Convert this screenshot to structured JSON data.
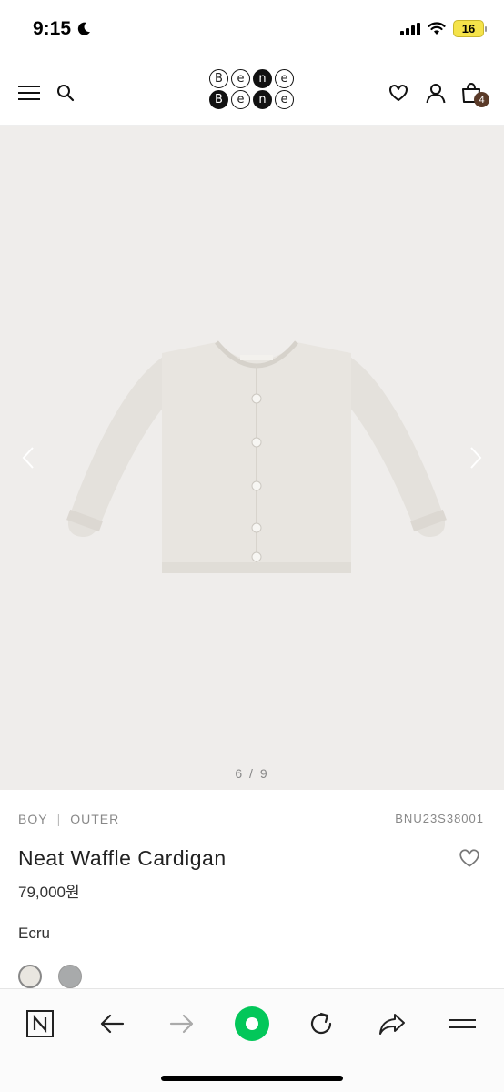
{
  "status_bar": {
    "time": "9:15",
    "battery": "16"
  },
  "header": {
    "logo_letters_top": [
      "B",
      "e",
      "n",
      "e"
    ],
    "logo_letters_bottom": [
      "B",
      "e",
      "n",
      "e"
    ],
    "cart_count": "4",
    "icons": [
      "menu-icon",
      "search-icon",
      "heart-icon",
      "user-icon",
      "shopping-bag-icon"
    ]
  },
  "gallery": {
    "counter": "6 / 9",
    "current": 6,
    "total": 9
  },
  "product": {
    "category": "BOY",
    "subcategory": "OUTER",
    "code": "BNU23S38001",
    "name": "Neat Waffle Cardigan",
    "price": "79,000원",
    "color_label": "Ecru",
    "swatches": [
      {
        "name": "Ecru",
        "color": "#e9e6e0",
        "selected": true
      },
      {
        "name": "Gray",
        "color": "#a8aaab",
        "selected": false
      }
    ]
  },
  "browser_toolbar": {
    "icons": [
      "naver-n-icon",
      "back-arrow-icon",
      "forward-arrow-icon",
      "green-home-icon",
      "refresh-icon",
      "share-icon",
      "more-menu-icon"
    ],
    "accent_color": "#03c75a"
  }
}
